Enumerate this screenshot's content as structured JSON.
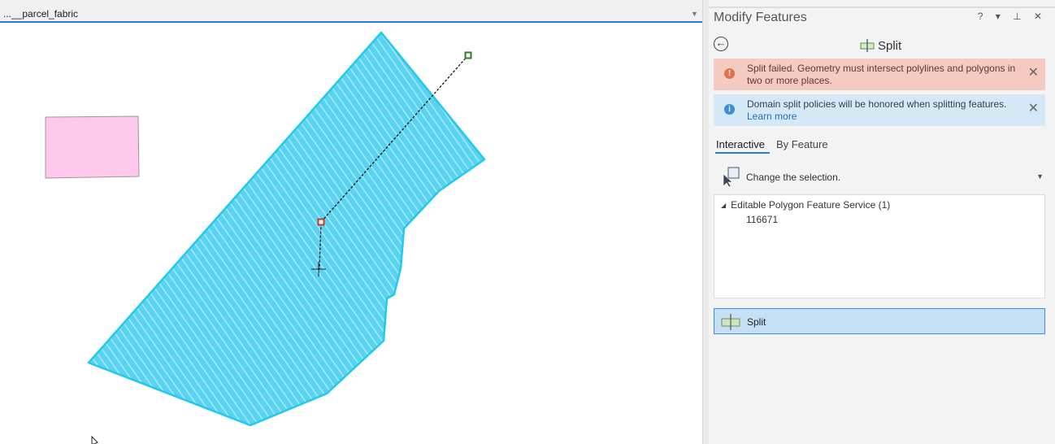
{
  "map": {
    "tab_label": "...__parcel_fabric",
    "tab_menu_icon": "chevron-down-icon"
  },
  "pane": {
    "title": "Modify Features",
    "controls": "? ▾ ⊥ ✕",
    "tool_name": "Split",
    "messages": {
      "error_text": "Split failed. Geometry must intersect polylines and polygons in two or more places.",
      "info_text": "Domain split policies will be honored when splitting features.",
      "info_link": "Learn more"
    },
    "tabs": {
      "interactive": "Interactive",
      "by_feature": "By Feature"
    },
    "selection_label": "Change the selection.",
    "tree": {
      "group": "Editable Polygon Feature Service (1)",
      "item": "116671"
    },
    "split_button_label": "Split"
  },
  "colors": {
    "accent": "#2e7bd1",
    "polygon_fill": "#5ad3f1",
    "polygon_outline": "#21c9ec",
    "parcel_pink": "#ffc7e9",
    "error_bg": "#f5cbc1",
    "info_bg": "#d5e8f6"
  }
}
